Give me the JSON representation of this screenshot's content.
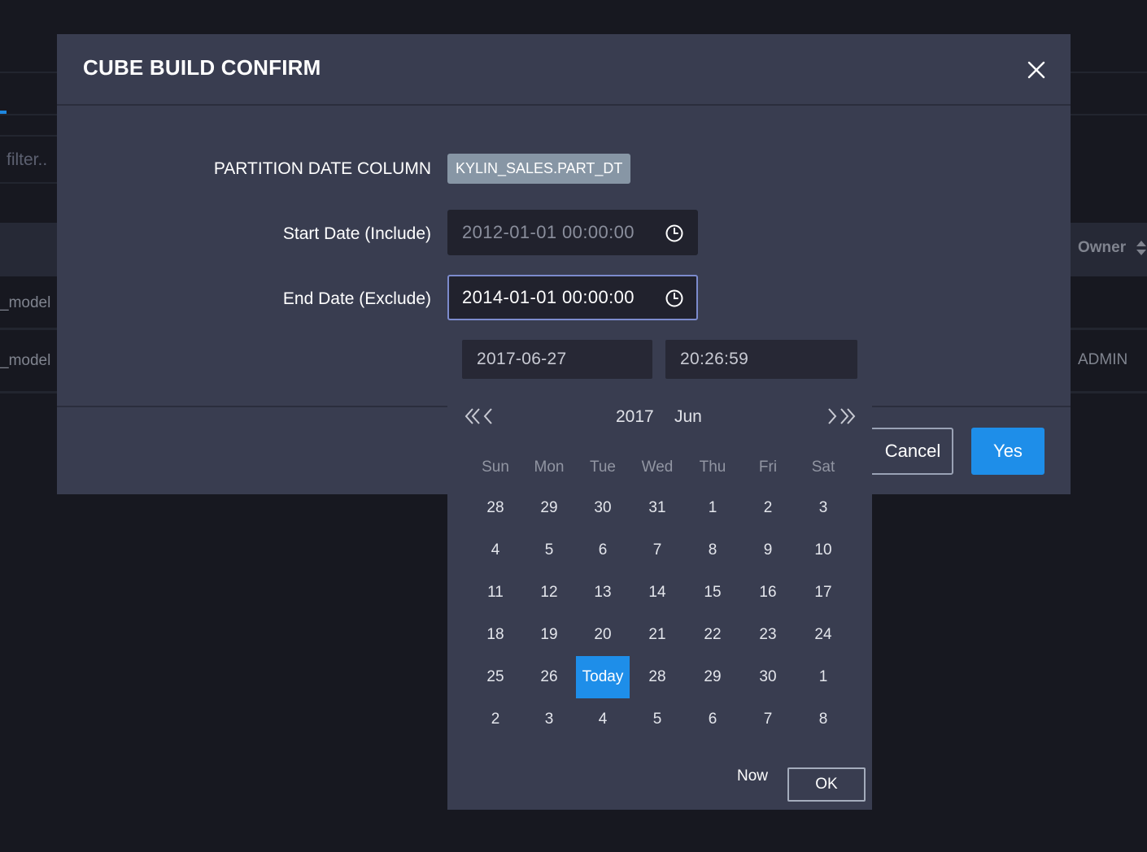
{
  "background": {
    "filter_placeholder": "filter..",
    "column_owner": "Owner",
    "rows": [
      {
        "name": "_model",
        "owner": ""
      },
      {
        "name": "_model",
        "owner": "ADMIN"
      }
    ]
  },
  "modal": {
    "title": "CUBE BUILD CONFIRM",
    "close_icon": "close-icon",
    "partition_label": "PARTITION DATE COLUMN",
    "partition_value": "KYLIN_SALES.PART_DT",
    "start_label": "Start Date (Include)",
    "start_value": "2012-01-01 00:00:00",
    "end_label": "End Date (Exclude)",
    "end_value": "2014-01-01 00:00:00",
    "cancel_label": "Cancel",
    "yes_label": "Yes"
  },
  "picker": {
    "date_value": "2017-06-27",
    "time_value": "20:26:59",
    "year": "2017",
    "month": "Jun",
    "weekdays": [
      "Sun",
      "Mon",
      "Tue",
      "Wed",
      "Thu",
      "Fri",
      "Sat"
    ],
    "weeks": [
      [
        "28",
        "29",
        "30",
        "31",
        "1",
        "2",
        "3"
      ],
      [
        "4",
        "5",
        "6",
        "7",
        "8",
        "9",
        "10"
      ],
      [
        "11",
        "12",
        "13",
        "14",
        "15",
        "16",
        "17"
      ],
      [
        "18",
        "19",
        "20",
        "21",
        "22",
        "23",
        "24"
      ],
      [
        "25",
        "26",
        "Today",
        "28",
        "29",
        "30",
        "1"
      ],
      [
        "2",
        "3",
        "4",
        "5",
        "6",
        "7",
        "8"
      ]
    ],
    "today_label": "Today",
    "now_label": "Now",
    "ok_label": "OK"
  },
  "colors": {
    "accent": "#1e8ee9",
    "modal_bg": "#393d50",
    "input_bg": "#21222d",
    "tag_bg": "#8796a5"
  }
}
